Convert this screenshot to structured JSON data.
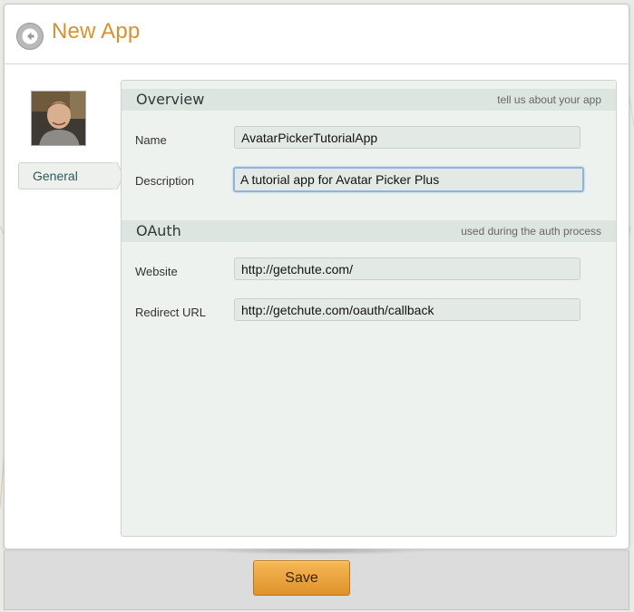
{
  "header": {
    "title": "New App"
  },
  "sidebar": {
    "items": [
      {
        "label": "General"
      }
    ]
  },
  "overview": {
    "title": "Overview",
    "hint": "tell us about your app",
    "fields": {
      "name": {
        "label": "Name",
        "value": "AvatarPickerTutorialApp"
      },
      "description": {
        "label": "Description",
        "value": "A tutorial app for Avatar Picker Plus"
      }
    }
  },
  "oauth": {
    "title": "OAuth",
    "hint": "used during the auth process",
    "fields": {
      "website": {
        "label": "Website",
        "value": "http://getchute.com/"
      },
      "redirect": {
        "label": "Redirect URL",
        "value": "http://getchute.com/oauth/callback"
      }
    }
  },
  "footer": {
    "save_label": "Save"
  },
  "colors": {
    "accent": "#d9912f",
    "button": "#e8a23d",
    "panel": "#eef2ef"
  }
}
